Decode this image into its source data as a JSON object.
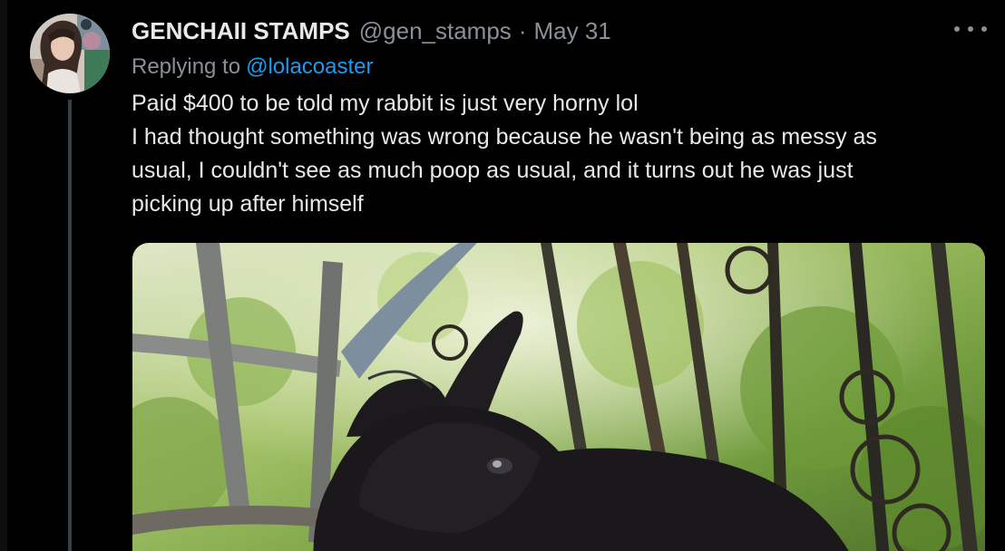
{
  "tweet": {
    "display_name": "GENCHAII STAMPS",
    "handle": "@gen_stamps",
    "separator": "·",
    "date": "May 31",
    "replying_to_label": "Replying to",
    "replying_to_handle": "@lolacoaster",
    "text_lines": [
      "Paid $400 to be told my rabbit is just very horny lol",
      "I had thought something was wrong because he wasn't being as messy as",
      "usual, I couldn't see as much poop as usual, and it turns out he was just",
      "picking up after himself"
    ],
    "more_icon": "more-horizontal-icon",
    "media_subject": "black-rabbit-photo"
  },
  "colors": {
    "background": "#000000",
    "primary_text": "#e7e9ea",
    "secondary_text": "#8b9096",
    "link": "#1d9bf0",
    "thread_line": "#3a3f45"
  }
}
